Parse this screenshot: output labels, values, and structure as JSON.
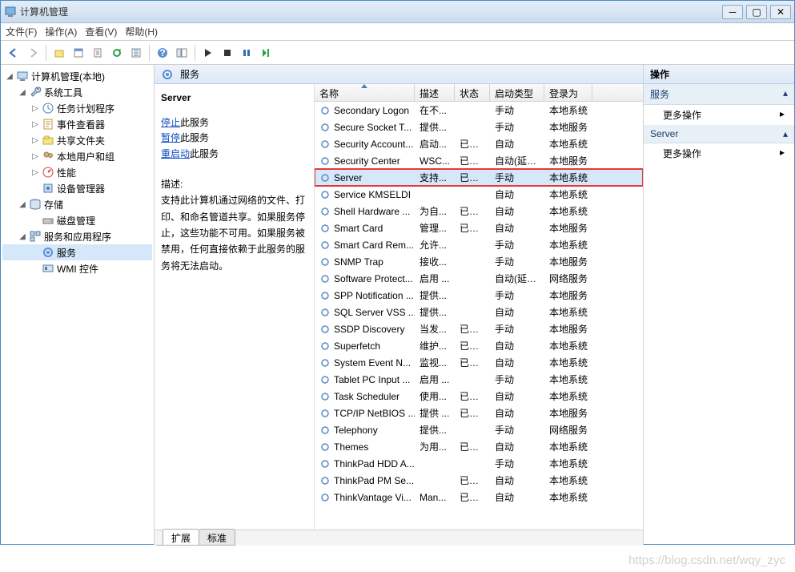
{
  "window": {
    "title": "计算机管理"
  },
  "menu": {
    "file": "文件(F)",
    "action": "操作(A)",
    "view": "查看(V)",
    "help": "帮助(H)"
  },
  "tree": [
    {
      "label": "计算机管理(本地)",
      "icon": "computer",
      "expanded": true,
      "level": 0
    },
    {
      "label": "系统工具",
      "icon": "wrench",
      "expanded": true,
      "level": 1
    },
    {
      "label": "任务计划程序",
      "icon": "clock",
      "level": 2,
      "has_children": true
    },
    {
      "label": "事件查看器",
      "icon": "event",
      "level": 2,
      "has_children": true
    },
    {
      "label": "共享文件夹",
      "icon": "share",
      "level": 2,
      "has_children": true
    },
    {
      "label": "本地用户和组",
      "icon": "users",
      "level": 2,
      "has_children": true
    },
    {
      "label": "性能",
      "icon": "perf",
      "level": 2,
      "has_children": true
    },
    {
      "label": "设备管理器",
      "icon": "device",
      "level": 2
    },
    {
      "label": "存储",
      "icon": "storage",
      "expanded": true,
      "level": 1
    },
    {
      "label": "磁盘管理",
      "icon": "disk",
      "level": 2
    },
    {
      "label": "服务和应用程序",
      "icon": "apps",
      "expanded": true,
      "level": 1
    },
    {
      "label": "服务",
      "icon": "services",
      "level": 2,
      "selected": true
    },
    {
      "label": "WMI 控件",
      "icon": "wmi",
      "level": 2
    }
  ],
  "center_title": "服务",
  "detail": {
    "name": "Server",
    "links": {
      "stop_pre": "停止",
      "stop_post": "此服务",
      "pause_pre": "暂停",
      "pause_post": "此服务",
      "restart_pre": "重启动",
      "restart_post": "此服务"
    },
    "desc_label": "描述:",
    "description": "支持此计算机通过网络的文件、打印、和命名管道共享。如果服务停止，这些功能不可用。如果服务被禁用，任何直接依赖于此服务的服务将无法启动。"
  },
  "columns": {
    "name": "名称",
    "desc": "描述",
    "status": "状态",
    "start": "启动类型",
    "logon": "登录为"
  },
  "services": [
    {
      "name": "Secondary Logon",
      "desc": "在不...",
      "status": "",
      "start": "手动",
      "logon": "本地系统"
    },
    {
      "name": "Secure Socket T...",
      "desc": "提供...",
      "status": "",
      "start": "手动",
      "logon": "本地服务"
    },
    {
      "name": "Security Account...",
      "desc": "启动...",
      "status": "已启动",
      "start": "自动",
      "logon": "本地系统"
    },
    {
      "name": "Security Center",
      "desc": "WSC...",
      "status": "已启动",
      "start": "自动(延迟...",
      "logon": "本地服务"
    },
    {
      "name": "Server",
      "desc": "支持...",
      "status": "已启动",
      "start": "手动",
      "logon": "本地系统",
      "selected": true,
      "highlight": true
    },
    {
      "name": "Service KMSELDI",
      "desc": "",
      "status": "",
      "start": "自动",
      "logon": "本地系统"
    },
    {
      "name": "Shell Hardware ...",
      "desc": "为自...",
      "status": "已启动",
      "start": "自动",
      "logon": "本地系统"
    },
    {
      "name": "Smart Card",
      "desc": "管理...",
      "status": "已启动",
      "start": "自动",
      "logon": "本地服务"
    },
    {
      "name": "Smart Card Rem...",
      "desc": "允许...",
      "status": "",
      "start": "手动",
      "logon": "本地系统"
    },
    {
      "name": "SNMP Trap",
      "desc": "接收...",
      "status": "",
      "start": "手动",
      "logon": "本地服务"
    },
    {
      "name": "Software Protect...",
      "desc": "启用 ...",
      "status": "",
      "start": "自动(延迟...",
      "logon": "网络服务"
    },
    {
      "name": "SPP Notification ...",
      "desc": "提供...",
      "status": "",
      "start": "手动",
      "logon": "本地服务"
    },
    {
      "name": "SQL Server VSS ...",
      "desc": "提供...",
      "status": "",
      "start": "自动",
      "logon": "本地系统"
    },
    {
      "name": "SSDP Discovery",
      "desc": "当发...",
      "status": "已启动",
      "start": "手动",
      "logon": "本地服务"
    },
    {
      "name": "Superfetch",
      "desc": "维护...",
      "status": "已启动",
      "start": "自动",
      "logon": "本地系统"
    },
    {
      "name": "System Event N...",
      "desc": "监视...",
      "status": "已启动",
      "start": "自动",
      "logon": "本地系统"
    },
    {
      "name": "Tablet PC Input ...",
      "desc": "启用 ...",
      "status": "",
      "start": "手动",
      "logon": "本地系统"
    },
    {
      "name": "Task Scheduler",
      "desc": "使用...",
      "status": "已启动",
      "start": "自动",
      "logon": "本地系统"
    },
    {
      "name": "TCP/IP NetBIOS ...",
      "desc": "提供 ...",
      "status": "已启动",
      "start": "自动",
      "logon": "本地服务"
    },
    {
      "name": "Telephony",
      "desc": "提供...",
      "status": "",
      "start": "手动",
      "logon": "网络服务"
    },
    {
      "name": "Themes",
      "desc": "为用...",
      "status": "已启动",
      "start": "自动",
      "logon": "本地系统"
    },
    {
      "name": "ThinkPad HDD A...",
      "desc": "",
      "status": "",
      "start": "手动",
      "logon": "本地系统"
    },
    {
      "name": "ThinkPad PM Se...",
      "desc": "",
      "status": "已启动",
      "start": "自动",
      "logon": "本地系统"
    },
    {
      "name": "ThinkVantage Vi...",
      "desc": "Man...",
      "status": "已启动",
      "start": "自动",
      "logon": "本地系统"
    }
  ],
  "tabs": {
    "ext": "扩展",
    "std": "标准"
  },
  "actions": {
    "header": "操作",
    "groups": [
      {
        "title": "服务",
        "items": [
          "更多操作"
        ]
      },
      {
        "title": "Server",
        "items": [
          "更多操作"
        ]
      }
    ]
  },
  "watermark": "https://blog.csdn.net/wqy_zyc"
}
